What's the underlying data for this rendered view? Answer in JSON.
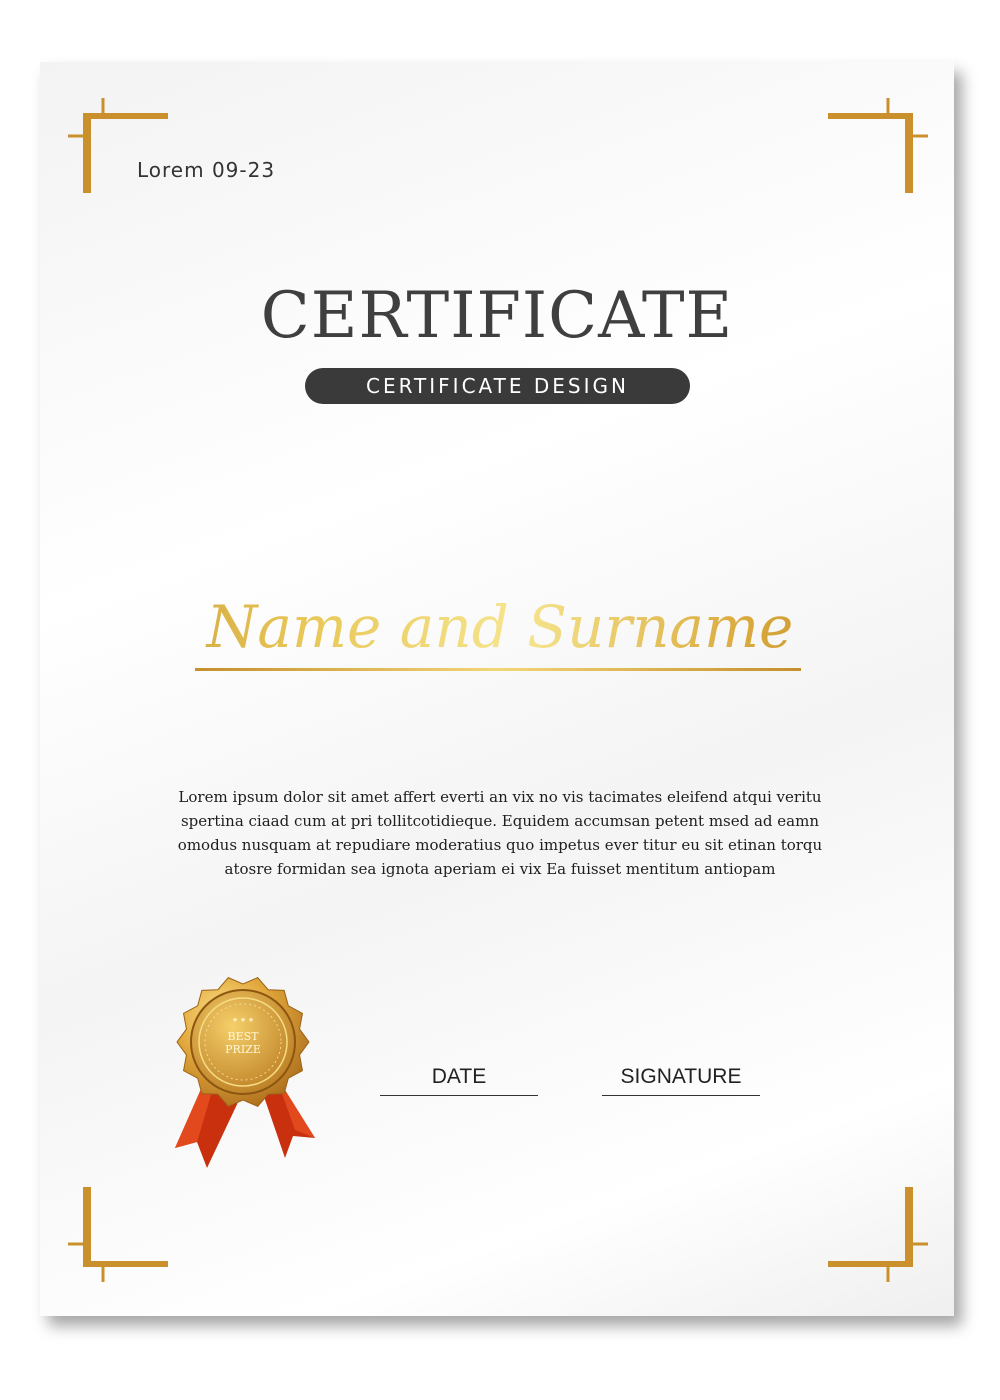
{
  "certificate": {
    "date_code": "Lorem 09-23",
    "title": "CERTIFICATE",
    "subtitle": "CERTIFICATE DESIGN",
    "recipient_name": "Name and Surname",
    "body_lines": [
      "Lorem ipsum dolor sit amet affert everti an vix no vis tacimates eleifend atqui veritu",
      "spertina ciaad cum at pri tollitcotidieque.  Equidem accumsan petent msed ad eamn",
      "omodus nusquam at repudiare moderatius quo impetus ever titur eu sit etinan torqu",
      "atosre formidan sea ignota aperiam ei vix Ea fuisset mentitum antiopam"
    ],
    "date_label": "DATE",
    "signature_label": "SIGNATURE",
    "seal": {
      "icon": "award-medal-icon",
      "text_line1": "BEST",
      "text_line2": "PRIZE"
    },
    "colors": {
      "gold": "#d4a23a",
      "gold_light": "#f6e58e",
      "pill": "#3a3a3a",
      "ribbon": "#c9300e"
    }
  }
}
